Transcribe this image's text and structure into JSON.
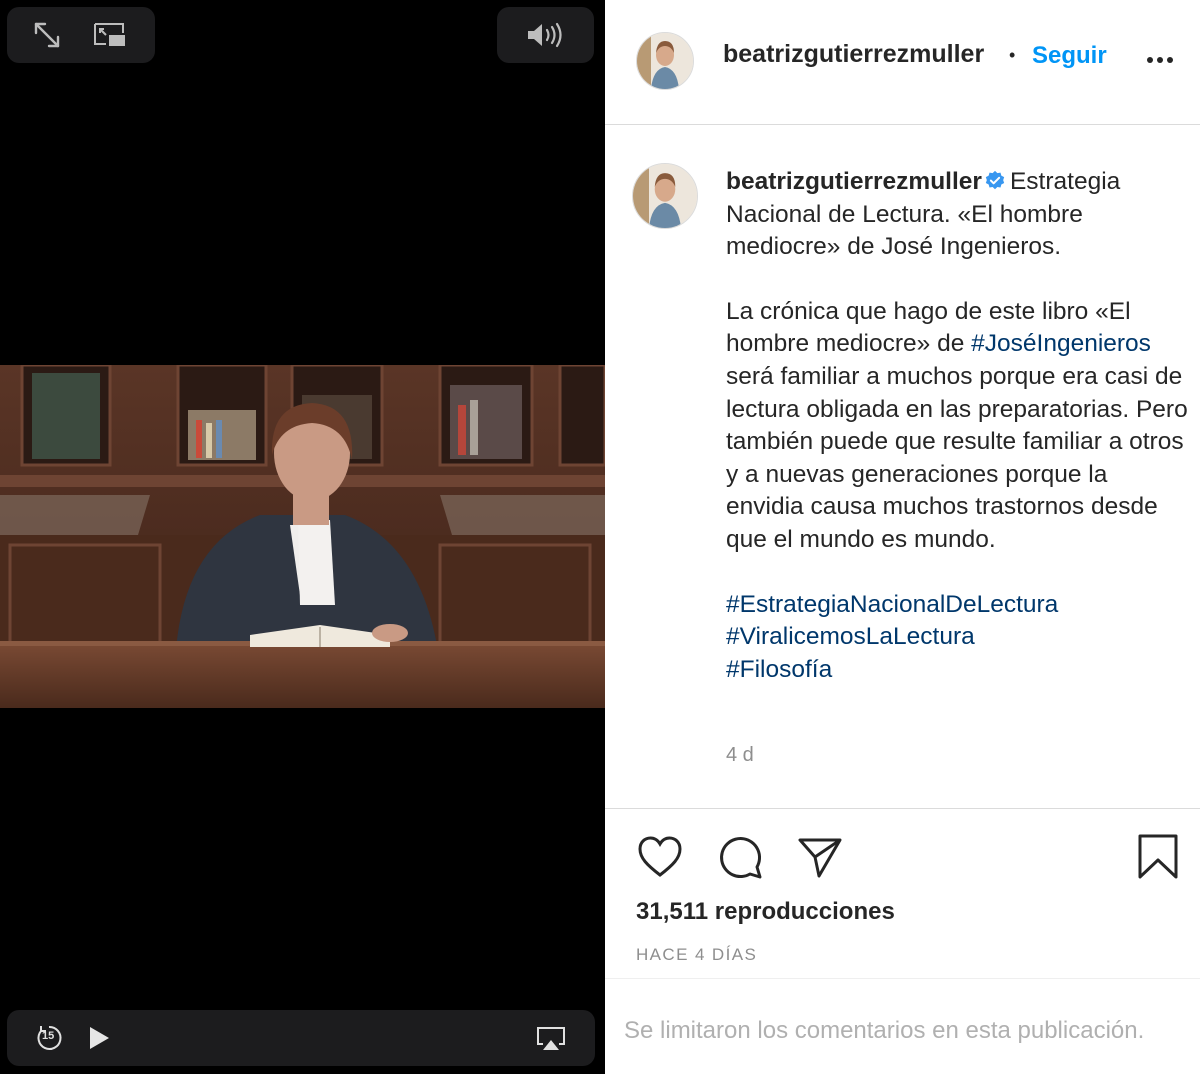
{
  "player": {
    "expand_icon": "expand-arrows-icon",
    "pip_icon": "picture-in-picture-icon",
    "volume_icon": "speaker-volume-icon",
    "rewind_label": "15",
    "play_icon": "play-icon",
    "airplay_icon": "airplay-icon"
  },
  "header": {
    "username": "beatrizgutierrezmuller",
    "separator": "•",
    "follow_label": "Seguir",
    "more_icon": "more-options-icon"
  },
  "post": {
    "username": "beatrizgutierrezmuller",
    "verified_icon": "verified-badge-icon",
    "caption_first": "Estrategia Nacional de Lectura. «El hombre mediocre» de José Ingenieros.",
    "paragraph2_before": "La crónica que hago de este libro «El hombre mediocre» de ",
    "paragraph2_tag": "#JoséIngenieros",
    "paragraph2_after": " será familiar a muchos porque era casi de lectura obligada en las preparatorias. Pero también puede que resulte familiar a otros y a nuevas generaciones porque la envidia causa muchos trastornos desde que el mundo es mundo.",
    "hashtags": [
      "#EstrategiaNacionalDeLectura",
      "#ViralicemosLaLectura",
      "#Filosofía"
    ],
    "relative_time": "4 d"
  },
  "actions": {
    "like_icon": "heart-icon",
    "comment_icon": "comment-bubble-icon",
    "share_icon": "paper-plane-icon",
    "save_icon": "bookmark-icon"
  },
  "stats": {
    "views": "31,511 reproducciones",
    "posted": "HACE 4 DÍAS"
  },
  "comments": {
    "disabled_notice": "Se limitaron los comentarios en esta publicación."
  },
  "colors": {
    "accent": "#0095f6",
    "hashtag": "#00376b",
    "text": "#262626",
    "muted": "#8e8e8e",
    "verified": "#3897f0"
  }
}
